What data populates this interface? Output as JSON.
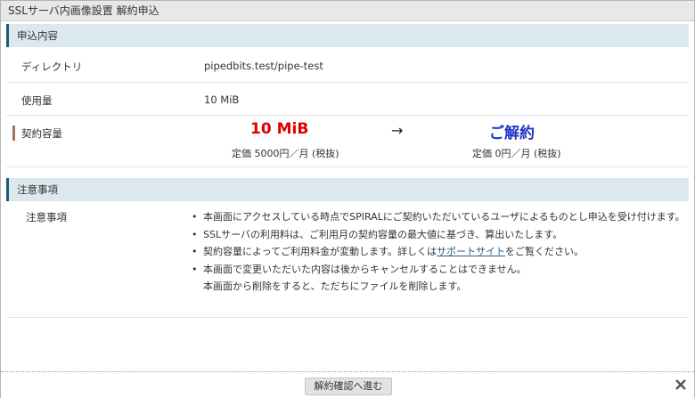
{
  "window": {
    "title": "SSLサーバ内画像設置 解約申込"
  },
  "application": {
    "section_title": "申込内容",
    "directory": {
      "label": "ディレクトリ",
      "value": "pipedbits.test/pipe-test"
    },
    "usage": {
      "label": "使用量",
      "value": "10 MiB"
    },
    "capacity": {
      "label": "契約容量",
      "before_amount": "10 MiB",
      "before_price": "定価 5000円／月 (税抜)",
      "arrow": "→",
      "after_amount": "ご解約",
      "after_price": "定価 0円／月 (税抜)"
    }
  },
  "notes": {
    "section_title": "注意事項",
    "label": "注意事項",
    "item1": "本画面にアクセスしている時点でSPIRALにご契約いただいているユーザによるものとし申込を受け付けます。",
    "item2": "SSLサーバの利用料は、ご利用月の契約容量の最大値に基づき、算出いたします。",
    "item3_before": "契約容量によってご利用料金が変動します。詳しくは",
    "item3_link": "サポートサイト",
    "item3_after": "をご覧ください。",
    "item4_line1": "本画面で変更いただいた内容は後からキャンセルすることはできません。",
    "item4_line2": "本画面から削除をすると、ただちにファイルを削除します。",
    "bullet": "•"
  },
  "footer": {
    "proceed_label": "解約確認へ進む",
    "close_icon": "close-icon"
  },
  "colors": {
    "section_bg": "#dbe9ef",
    "section_accent": "#1f5a77",
    "before_amount": "#e00000",
    "after_amount": "#1f33c7",
    "capacity_accent": "#a5735d"
  }
}
